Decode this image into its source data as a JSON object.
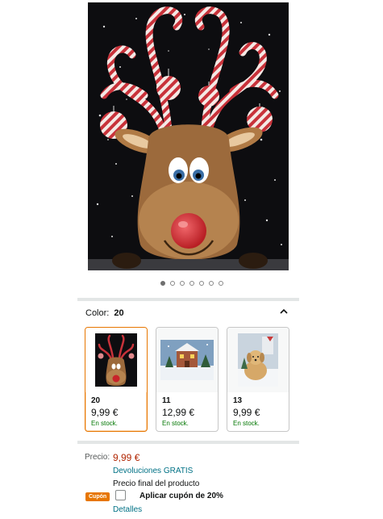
{
  "gallery": {
    "dot_count": 7,
    "active_index": 0
  },
  "variation": {
    "color_label": "Color:",
    "color_value": "20"
  },
  "swatches": [
    {
      "name": "20",
      "price": "9,99 €",
      "stock": "En stock.",
      "selected": true
    },
    {
      "name": "11",
      "price": "12,99 €",
      "stock": "En stock.",
      "selected": false
    },
    {
      "name": "13",
      "price": "9,99 €",
      "stock": "En stock.",
      "selected": false
    }
  ],
  "pricing": {
    "label": "Precio:",
    "value": "9,99 €",
    "returns": "Devoluciones GRATIS",
    "final_note": "Precio final del producto",
    "coupon_badge": "Cupón",
    "coupon_text": "Aplicar cupón de 20%",
    "details": "Detalles"
  },
  "colors": {
    "price": "#b12704",
    "link": "#007185",
    "stock": "#007600",
    "coupon": "#e77600",
    "selected_border": "#e77600"
  }
}
